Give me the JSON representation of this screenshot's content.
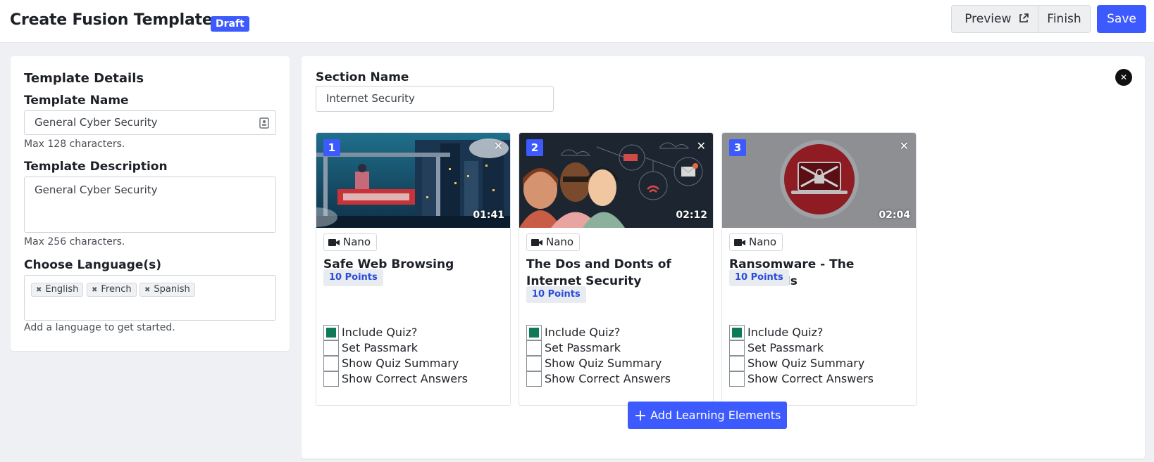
{
  "header": {
    "title": "Create Fusion Template",
    "badge": "Draft",
    "preview_label": "Preview",
    "finish_label": "Finish",
    "save_label": "Save"
  },
  "template_details": {
    "heading": "Template Details",
    "name_label": "Template Name",
    "name_value": "General Cyber Security",
    "name_hint": "Max 128 characters.",
    "description_label": "Template Description",
    "description_value": "General Cyber Security",
    "description_hint": "Max 256 characters.",
    "language_label": "Choose Language(s)",
    "languages": [
      "English",
      "French",
      "Spanish"
    ],
    "language_hint": "Add a language to get started."
  },
  "section": {
    "label": "Section Name",
    "value": "Internet Security"
  },
  "cards": [
    {
      "number": "1",
      "duration": "01:41",
      "type": "Nano",
      "title": "Safe Web Browsing",
      "points": "10 Points",
      "options": [
        {
          "label": "Include Quiz?",
          "checked": true
        },
        {
          "label": "Set Passmark",
          "checked": false
        },
        {
          "label": "Show Quiz Summary",
          "checked": false
        },
        {
          "label": "Show Correct Answers",
          "checked": false
        }
      ]
    },
    {
      "number": "2",
      "duration": "02:12",
      "type": "Nano",
      "title": "The Dos and Donts of Internet Security",
      "points": "10 Points",
      "options": [
        {
          "label": "Include Quiz?",
          "checked": true
        },
        {
          "label": "Set Passmark",
          "checked": false
        },
        {
          "label": "Show Quiz Summary",
          "checked": false
        },
        {
          "label": "Show Correct Answers",
          "checked": false
        }
      ]
    },
    {
      "number": "3",
      "duration": "02:04",
      "type": "Nano",
      "title": "Ransomware - The Essentials",
      "points": "10 Points",
      "options": [
        {
          "label": "Include Quiz?",
          "checked": true
        },
        {
          "label": "Set Passmark",
          "checked": false
        },
        {
          "label": "Show Quiz Summary",
          "checked": false
        },
        {
          "label": "Show Correct Answers",
          "checked": false
        }
      ]
    }
  ],
  "add_button_label": "Add Learning Elements",
  "colors": {
    "primary": "#3d5afe",
    "checkbox_checked": "#0e7a58",
    "points_text": "#2b4bdc"
  }
}
